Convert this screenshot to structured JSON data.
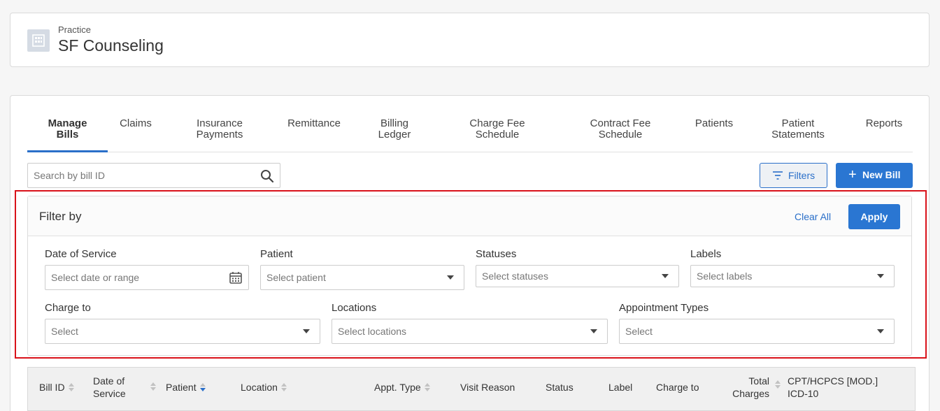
{
  "practice": {
    "label": "Practice",
    "name": "SF Counseling"
  },
  "tabs": [
    {
      "line1": "Manage",
      "line2": "Bills",
      "active": true
    },
    {
      "line1": "Claims",
      "line2": ""
    },
    {
      "line1": "Insurance",
      "line2": "Payments"
    },
    {
      "line1": "Remittance",
      "line2": ""
    },
    {
      "line1": "Billing",
      "line2": "Ledger"
    },
    {
      "line1": "Charge Fee",
      "line2": "Schedule"
    },
    {
      "line1": "Contract Fee",
      "line2": "Schedule"
    },
    {
      "line1": "Patients",
      "line2": ""
    },
    {
      "line1": "Patient",
      "line2": "Statements"
    },
    {
      "line1": "Reports",
      "line2": ""
    }
  ],
  "search": {
    "placeholder": "Search by bill ID"
  },
  "toolbar": {
    "filters_label": "Filters",
    "new_bill_label": "New Bill",
    "new_bill_icon": "+"
  },
  "filter_panel": {
    "title": "Filter by",
    "clear_all": "Clear All",
    "apply": "Apply",
    "fields": {
      "date_of_service": {
        "label": "Date of Service",
        "placeholder": "Select date or range"
      },
      "patient": {
        "label": "Patient",
        "placeholder": "Select patient"
      },
      "statuses": {
        "label": "Statuses",
        "placeholder": "Select statuses"
      },
      "labels": {
        "label": "Labels",
        "placeholder": "Select labels"
      },
      "charge_to": {
        "label": "Charge to",
        "placeholder": "Select"
      },
      "locations": {
        "label": "Locations",
        "placeholder": "Select locations"
      },
      "appointment_types": {
        "label": "Appointment Types",
        "placeholder": "Select"
      }
    }
  },
  "table": {
    "columns": {
      "bill_id": "Bill ID",
      "date_of_service_1": "Date of",
      "date_of_service_2": "Service",
      "patient": "Patient",
      "location": "Location",
      "appt_type": "Appt. Type",
      "visit_reason": "Visit Reason",
      "status": "Status",
      "label": "Label",
      "charge_to": "Charge to",
      "total_charges_1": "Total",
      "total_charges_2": "Charges",
      "cpt_1": "CPT/HCPCS [MOD.]",
      "cpt_2": "ICD-10"
    }
  },
  "colors": {
    "accent": "#2a76d2",
    "highlight": "#d9121a"
  }
}
